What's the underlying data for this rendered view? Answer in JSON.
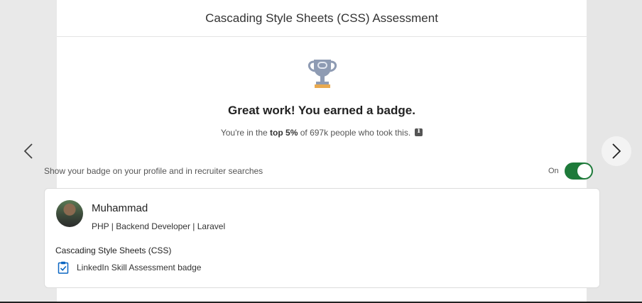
{
  "modal": {
    "title": "Cascading Style Sheets (CSS) Assessment"
  },
  "result": {
    "headline": "Great work! You earned a badge.",
    "sub_prefix": "You're in the ",
    "sub_bold": "top 5%",
    "sub_suffix": " of 697k people who took this.",
    "trophy_icon": "trophy-icon",
    "info_icon": "info-icon"
  },
  "visibility": {
    "label": "Show your badge on your profile and in recruiter searches",
    "state_label": "On",
    "enabled": true,
    "accent": "#1e7a3a"
  },
  "nav": {
    "prev_icon": "chevron-left-icon",
    "next_icon": "chevron-right-icon"
  },
  "profile_card": {
    "name": "Muhammad",
    "headline": "PHP | Backend Developer | Laravel",
    "skill": "Cascading Style Sheets (CSS)",
    "badge_label": "LinkedIn Skill Assessment badge",
    "badge_icon": "clipboard-check-icon",
    "badge_color": "#0a66c2"
  }
}
